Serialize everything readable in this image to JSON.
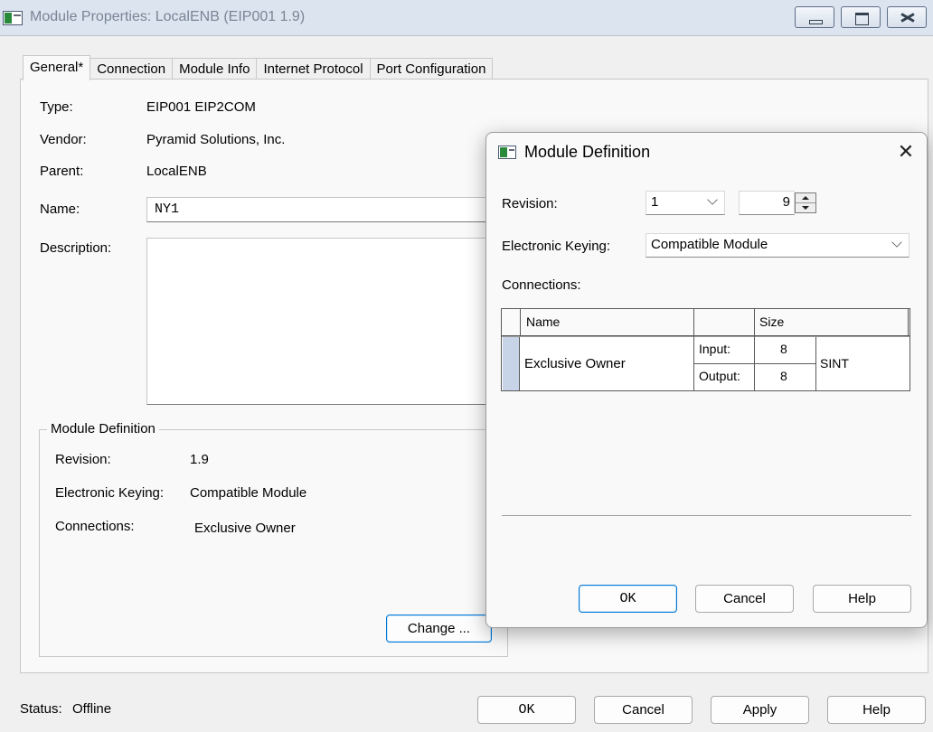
{
  "window": {
    "title": "Module Properties: LocalENB (EIP001 1.9)",
    "minimize_icon": "minimize-icon",
    "maximize_icon": "maximize-icon",
    "close_icon": "close-icon"
  },
  "tabs": [
    {
      "label": "General*",
      "active": true
    },
    {
      "label": "Connection",
      "active": false
    },
    {
      "label": "Module Info",
      "active": false
    },
    {
      "label": "Internet Protocol",
      "active": false
    },
    {
      "label": "Port Configuration",
      "active": false
    }
  ],
  "general": {
    "type_label": "Type:",
    "type_value": "EIP001 EIP2COM",
    "vendor_label": "Vendor:",
    "vendor_value": "Pyramid Solutions, Inc.",
    "parent_label": "Parent:",
    "parent_value": "LocalENB",
    "name_label": "Name:",
    "name_value": "NY1",
    "description_label": "Description:",
    "description_value": ""
  },
  "module_definition_group": {
    "title": "Module Definition",
    "revision_label": "Revision:",
    "revision_value": "1.9",
    "keying_label": "Electronic Keying:",
    "keying_value": "Compatible Module",
    "connections_label": "Connections:",
    "connections_value": "Exclusive Owner",
    "change_button": "Change ..."
  },
  "footer": {
    "status_label": "Status:",
    "status_value": "Offline",
    "ok_button": "OK",
    "cancel_button": "Cancel",
    "apply_button": "Apply",
    "help_button": "Help"
  },
  "dialog": {
    "title": "Module Definition",
    "close_glyph": "✕",
    "revision_label": "Revision:",
    "revision_major": "1",
    "revision_minor": "9",
    "keying_label": "Electronic Keying:",
    "keying_value": "Compatible Module",
    "connections_label": "Connections:",
    "table": {
      "headers": {
        "name": "Name",
        "blank": "",
        "size": "Size"
      },
      "rows": [
        {
          "name": "Exclusive Owner",
          "input_label": "Input:",
          "input_size": "8",
          "output_label": "Output:",
          "output_size": "8",
          "type": "SINT"
        }
      ]
    },
    "ok_button": "OK",
    "cancel_button": "Cancel",
    "help_button": "Help"
  }
}
